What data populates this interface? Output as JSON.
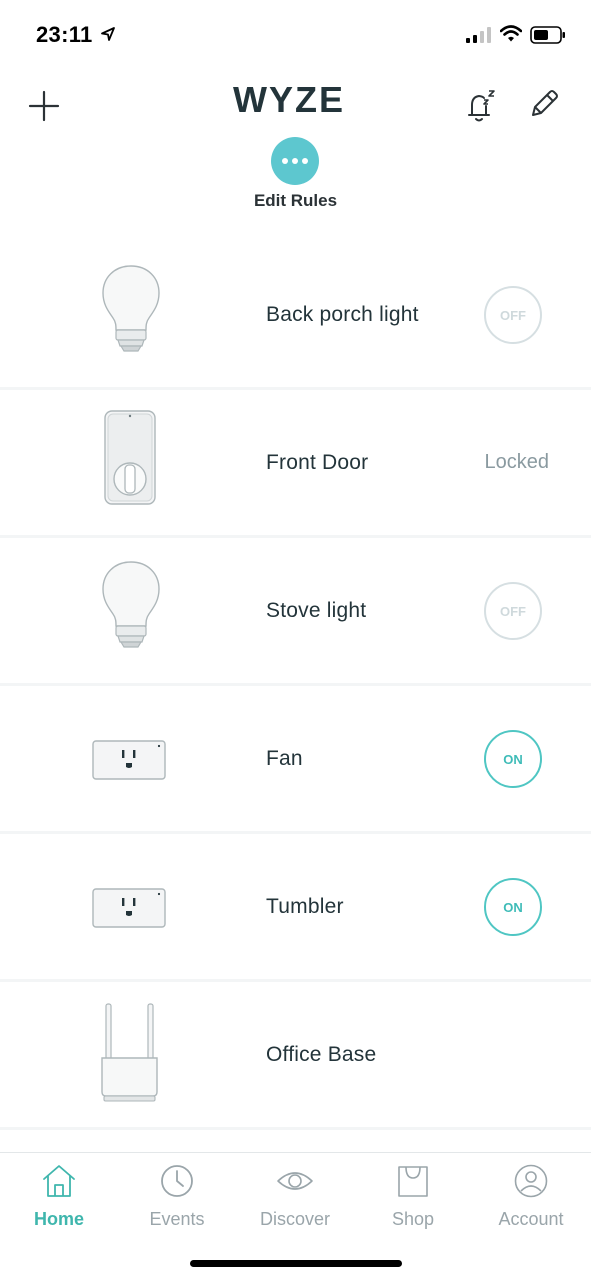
{
  "status_bar": {
    "time": "23:11"
  },
  "header": {
    "logo_text": "WYZE",
    "rules_label": "Edit Rules"
  },
  "devices": [
    {
      "name": "Back porch light",
      "type": "bulb",
      "state": "OFF"
    },
    {
      "name": "Front Door",
      "type": "lock",
      "status": "Locked"
    },
    {
      "name": "Stove light",
      "type": "bulb",
      "state": "OFF"
    },
    {
      "name": "Fan",
      "type": "plug",
      "state": "ON"
    },
    {
      "name": "Tumbler",
      "type": "plug",
      "state": "ON"
    },
    {
      "name": "Office Base",
      "type": "base-station"
    }
  ],
  "tabs": [
    {
      "label": "Home",
      "icon": "home-icon",
      "active": true
    },
    {
      "label": "Events",
      "icon": "clock-icon",
      "active": false
    },
    {
      "label": "Discover",
      "icon": "eye-icon",
      "active": false
    },
    {
      "label": "Shop",
      "icon": "bag-icon",
      "active": false
    },
    {
      "label": "Account",
      "icon": "user-icon",
      "active": false
    }
  ],
  "colors": {
    "accent": "#4fc6c3",
    "rules_button": "#5dc7cf",
    "off_toggle": "#d6dfe2",
    "text": "#23343a",
    "tab_inactive": "#9aa5aa"
  }
}
